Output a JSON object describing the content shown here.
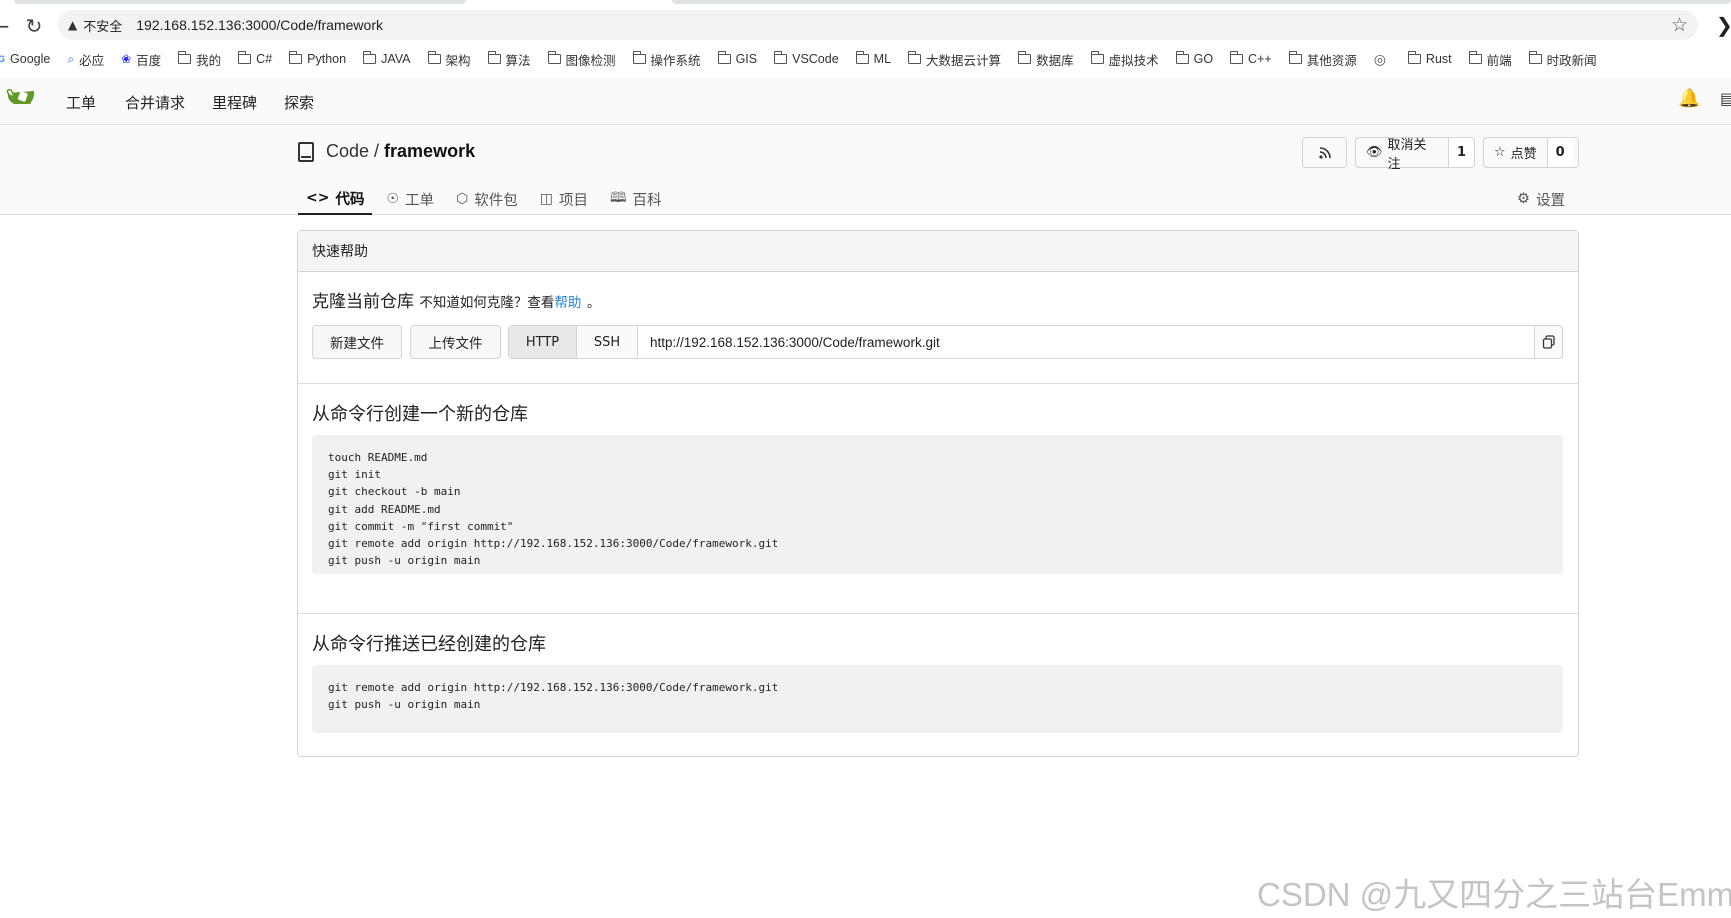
{
  "browser": {
    "security_label": "不安全",
    "url": "192.168.152.136:3000/Code/framework",
    "bookmarks": [
      {
        "label": "Google",
        "icon": "google-icon"
      },
      {
        "label": "必应",
        "icon": "bing-icon"
      },
      {
        "label": "百度",
        "icon": "baidu-icon"
      },
      {
        "label": "我的",
        "icon": "folder-icon"
      },
      {
        "label": "C#",
        "icon": "folder-icon"
      },
      {
        "label": "Python",
        "icon": "folder-icon"
      },
      {
        "label": "JAVA",
        "icon": "folder-icon"
      },
      {
        "label": "架构",
        "icon": "folder-icon"
      },
      {
        "label": "算法",
        "icon": "folder-icon"
      },
      {
        "label": "图像检测",
        "icon": "folder-icon"
      },
      {
        "label": "操作系统",
        "icon": "folder-icon"
      },
      {
        "label": "GIS",
        "icon": "folder-icon"
      },
      {
        "label": "VSCode",
        "icon": "folder-icon"
      },
      {
        "label": "ML",
        "icon": "folder-icon"
      },
      {
        "label": "大数据云计算",
        "icon": "folder-icon"
      },
      {
        "label": "数据库",
        "icon": "folder-icon"
      },
      {
        "label": "虚拟技术",
        "icon": "folder-icon"
      },
      {
        "label": "GO",
        "icon": "folder-icon"
      },
      {
        "label": "C++",
        "icon": "folder-icon"
      },
      {
        "label": "其他资源",
        "icon": "folder-icon"
      },
      {
        "label": "",
        "icon": "globe-icon"
      },
      {
        "label": "Rust",
        "icon": "folder-icon"
      },
      {
        "label": "前端",
        "icon": "folder-icon"
      },
      {
        "label": "时政新闻",
        "icon": "folder-icon"
      }
    ]
  },
  "nav": {
    "items": [
      "工单",
      "合并请求",
      "里程碑",
      "探索"
    ]
  },
  "repo": {
    "owner": "Code",
    "separator": "/",
    "name": "framework",
    "unwatch_label": "取消关注",
    "watch_count": "1",
    "star_label": "点赞",
    "star_count": "0",
    "tabs": [
      {
        "label": "代码",
        "icon": "code-icon",
        "active": true
      },
      {
        "label": "工单",
        "icon": "issue-icon",
        "active": false
      },
      {
        "label": "软件包",
        "icon": "package-icon",
        "active": false
      },
      {
        "label": "项目",
        "icon": "project-icon",
        "active": false
      },
      {
        "label": "百科",
        "icon": "book-icon",
        "active": false
      }
    ],
    "settings_label": "设置"
  },
  "quickstart": {
    "header": "快速帮助",
    "clone_title": "克隆当前仓库",
    "clone_hint": "不知道如何克隆？查看",
    "help_link": "帮助",
    "clone_hint_end": "。",
    "new_file": "新建文件",
    "upload_file": "上传文件",
    "http": "HTTP",
    "ssh": "SSH",
    "clone_url": "http://192.168.152.136:3000/Code/framework.git",
    "new_repo_title": "从命令行创建一个新的仓库",
    "new_repo_code": "touch README.md\ngit init\ngit checkout -b main\ngit add README.md\ngit commit -m \"first commit\"\ngit remote add origin http://192.168.152.136:3000/Code/framework.git\ngit push -u origin main",
    "push_repo_title": "从命令行推送已经创建的仓库",
    "push_repo_code": "git remote add origin http://192.168.152.136:3000/Code/framework.git\ngit push -u origin main"
  },
  "watermark": "CSDN @九又四分之三站台Emm"
}
